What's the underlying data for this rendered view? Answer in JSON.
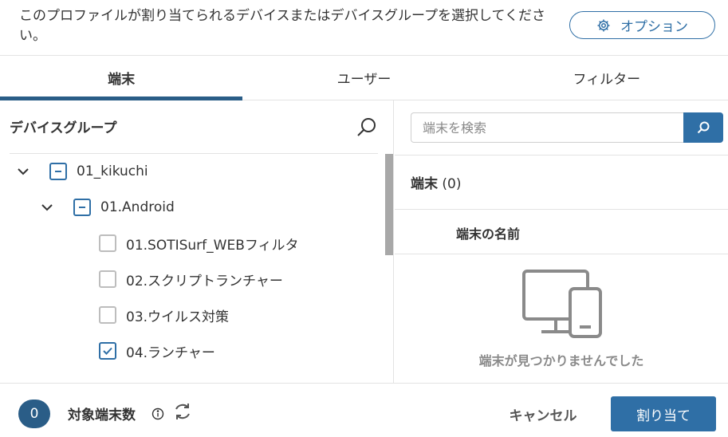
{
  "header": {
    "instruction": "このプロファイルが割り当てられるデバイスまたはデバイスグループを選択してください。",
    "options_label": "オプション",
    "options_icon": "gear-icon"
  },
  "tabs": [
    {
      "label": "端末",
      "active": true
    },
    {
      "label": "ユーザー",
      "active": false
    },
    {
      "label": "フィルター",
      "active": false
    }
  ],
  "device_groups": {
    "title": "デバイスグループ",
    "search_icon": "search-icon",
    "tree": [
      {
        "label": "01_kikuchi",
        "level": 0,
        "expanded": true,
        "state": "partial"
      },
      {
        "label": "01.Android",
        "level": 1,
        "expanded": true,
        "state": "partial"
      },
      {
        "label": "01.SOTISurf_WEBフィルタ",
        "level": 2,
        "state": "unchecked"
      },
      {
        "label": "02.スクリプトランチャー",
        "level": 2,
        "state": "unchecked"
      },
      {
        "label": "03.ウイルス対策",
        "level": 2,
        "state": "unchecked"
      },
      {
        "label": "04.ランチャー",
        "level": 2,
        "state": "checked"
      }
    ]
  },
  "devices": {
    "search_placeholder": "端末を検索",
    "title": "端末",
    "count": "(0)",
    "column_name": "端末の名前",
    "empty_message": "端末が見つかりませんでした",
    "empty_icon": "devices-icon"
  },
  "footer": {
    "target_count": "0",
    "target_label": "対象端末数",
    "cancel_label": "キャンセル",
    "assign_label": "割り当て"
  },
  "colors": {
    "accent": "#2f6fa6",
    "tab_indicator": "#2a5d87",
    "border": "#e3e3e3",
    "muted_icon": "#8a8a8a"
  }
}
